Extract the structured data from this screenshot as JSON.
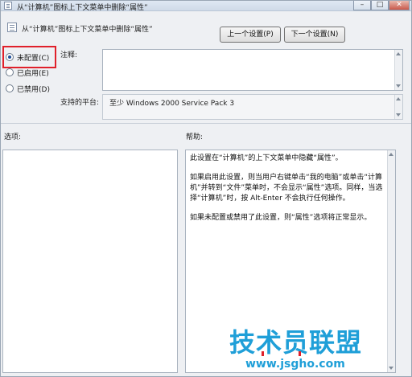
{
  "window": {
    "title": "从“计算机”图标上下文菜单中删除“属性”",
    "controls": {
      "minimize": "–",
      "maximize": "□",
      "close": "✕"
    }
  },
  "header": {
    "policy_title": "从“计算机”图标上下文菜单中删除“属性”"
  },
  "buttons": {
    "prev_label": "上一个设置(P)",
    "next_label": "下一个设置(N)"
  },
  "radios": [
    {
      "label": "未配置(C)",
      "checked": true
    },
    {
      "label": "已启用(E)",
      "checked": false
    },
    {
      "label": "已禁用(D)",
      "checked": false
    }
  ],
  "comment": {
    "label": "注释:",
    "value": ""
  },
  "platform": {
    "label": "支持的平台:",
    "value": "至少 Windows 2000 Service Pack 3"
  },
  "options": {
    "label": "选项:"
  },
  "help": {
    "label": "帮助:",
    "paragraphs": [
      "此设置在“计算机”的上下文菜单中隐藏“属性”。",
      "如果启用此设置，则当用户右键单击“我的电脑”或单击“计算机”并转到“文件”菜单时，不会显示“属性”选项。同样，当选择“计算机”时，按 Alt-Enter 不会执行任何操作。",
      "如果未配置或禁用了此设置，则“属性”选项将正常显示。"
    ]
  },
  "watermark": {
    "main": "技术员联盟",
    "url": "www.jsgho.com"
  }
}
